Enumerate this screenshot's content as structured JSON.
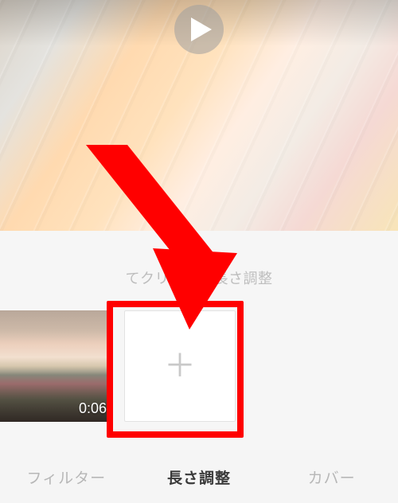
{
  "hint_text": "てクリップの長さ調整",
  "clip": {
    "duration_label": "0:06"
  },
  "tabs": {
    "filter": "フィルター",
    "trim": "長さ調整",
    "cover": "カバー"
  }
}
